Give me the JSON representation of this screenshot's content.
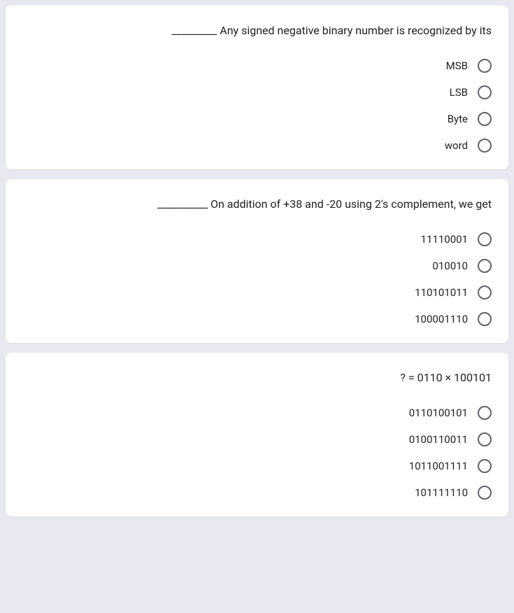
{
  "questions": [
    {
      "text": "_________ Any signed negative binary number is recognized by its",
      "options": [
        "MSB",
        "LSB",
        "Byte",
        "word"
      ]
    },
    {
      "text": "__________ On addition of +38 and -20 using 2's complement, we get",
      "options": [
        "11110001",
        "010010",
        "110101011",
        "100001110"
      ]
    },
    {
      "text": "? = 0110 × 100101",
      "options": [
        "0110100101",
        "0100110011",
        "1011001111",
        "101111110"
      ]
    }
  ]
}
